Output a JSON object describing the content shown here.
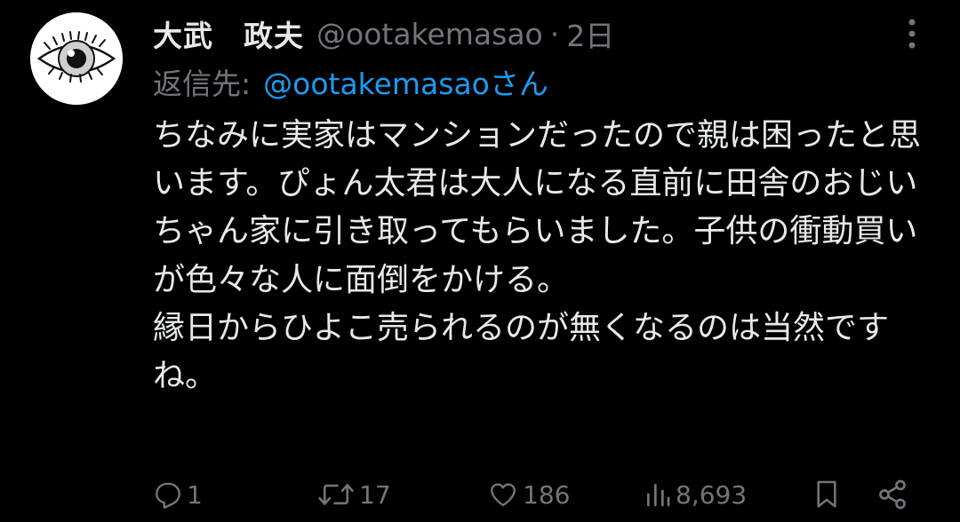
{
  "author": {
    "display_name": "大武　政夫",
    "handle": "@ootakemasao",
    "separator": "·",
    "time": "2日",
    "avatar_icon": "eye-icon"
  },
  "reply": {
    "prefix": "返信先:",
    "target": "@ootakemasaoさん"
  },
  "tweet": {
    "text": "ちなみに実家はマンションだったので親は困ったと思います。ぴょん太君は大人になる直前に田舎のおじいちゃん家に引き取ってもらいました。子供の衝動買いが色々な人に面倒をかける。\n縁日からひよこ売られるのが無くなるのは当然ですね。"
  },
  "actions": {
    "reply": {
      "icon": "reply-icon",
      "count": "1"
    },
    "repost": {
      "icon": "repost-icon",
      "count": "17"
    },
    "like": {
      "icon": "heart-icon",
      "count": "186"
    },
    "views": {
      "icon": "views-icon",
      "count": "8,693"
    },
    "bookmark": {
      "icon": "bookmark-icon"
    },
    "share": {
      "icon": "share-icon"
    }
  },
  "colors": {
    "background": "#000000",
    "primary_text": "#e7e9ea",
    "secondary_text": "#71767b",
    "accent": "#1d9bf0"
  }
}
